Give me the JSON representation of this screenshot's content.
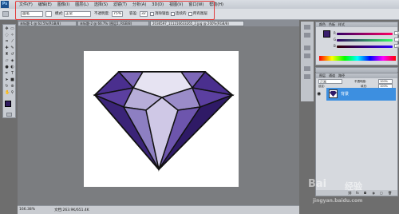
{
  "app": {
    "logo_text": "Ps"
  },
  "menu": {
    "items": [
      "文件(F)",
      "编辑(E)",
      "图像(I)",
      "图层(L)",
      "选择(S)",
      "滤镜(T)",
      "分析(A)",
      "3D(D)",
      "视图(V)",
      "窗口(W)",
      "帮助(H)"
    ]
  },
  "options": {
    "preset_value": "画笔",
    "mode_label": "模式:",
    "mode_value": "正常",
    "opacity_label": "不透明度:",
    "opacity_value": "75%",
    "tolerance_label": "容差:",
    "tolerance_value": "32",
    "antialias_label": "消除锯齿",
    "contiguous_label": "连续的",
    "all_layers_label": "所有图层"
  },
  "tabs": [
    {
      "label": "未标题-1 @ 62.5%(RGB/8)"
    },
    {
      "label": "未标题-2 @ 66.7% (图层1, RGB/8)"
    },
    {
      "label": "2036597_111216633265_2.jpg @ 200%(RGB/8)"
    }
  ],
  "status": {
    "zoom": "166.38%",
    "doc_info": "文档:263.9K/651.4K"
  },
  "color_panel": {
    "tabs": [
      "颜色",
      "色板",
      "样式"
    ],
    "r_label": "R",
    "r_value": "50",
    "g_label": "G",
    "g_value": "0",
    "b_label": "B",
    "b_value": "100",
    "fg_color": "#3a1f6e"
  },
  "layers_panel": {
    "tabs": [
      "图层",
      "通道",
      "路径"
    ],
    "blend_mode": "正常",
    "opacity_label": "不透明度:",
    "opacity_value": "100%",
    "fill_label": "填充:",
    "fill_value": "100%",
    "lock_label": "锁定:",
    "layer_name": "背景"
  },
  "toolbox": {
    "fg_color": "#2e1a5e",
    "bg_color": "#ffffff"
  },
  "watermark": {
    "text": "jingyan.baidu.com"
  },
  "colors": {
    "accent": "#3d8fe0",
    "highlight": "#e23b3b",
    "gem_dark": "#2f1a66",
    "gem_mid": "#5b3fa0",
    "gem_light": "#e6e3f2"
  }
}
